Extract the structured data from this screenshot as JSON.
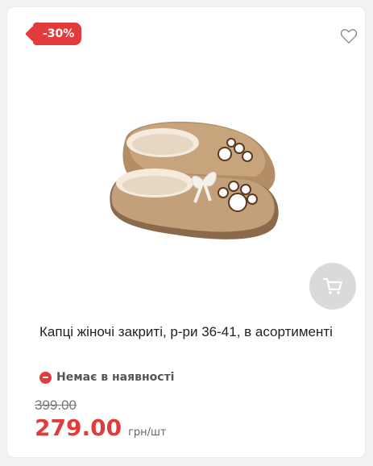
{
  "product": {
    "discount_badge": "-30%",
    "title": "Капці жіночі закриті, р-ри 36-41, в асортименті",
    "availability": "Немає в наявності",
    "old_price": "399.00",
    "price": "279.00",
    "unit": "грн/шт",
    "image_alt": "Капці жіночі"
  },
  "icons": {
    "favorite": "heart-icon",
    "cart": "cart-icon",
    "availability": "minus-circle-icon"
  },
  "colors": {
    "accent": "#e33b3b",
    "cart_button": "#dadada",
    "slipper": "#c4a07a"
  }
}
